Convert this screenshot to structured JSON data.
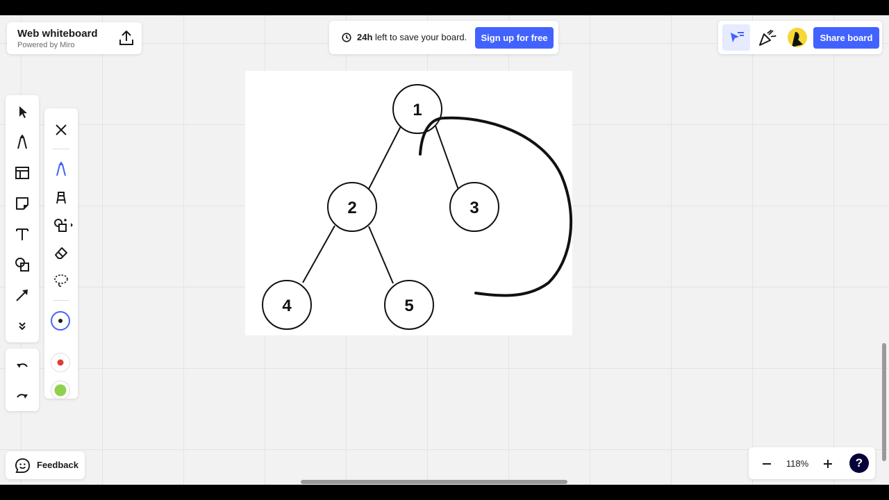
{
  "board": {
    "title": "Web whiteboard",
    "subtitle": "Powered by Miro"
  },
  "save_banner": {
    "hours_bold": "24h",
    "text": " left to save your board.",
    "signup_label": "Sign up for free"
  },
  "top_right": {
    "share_label": "Share board"
  },
  "toolbar": {
    "tools": [
      "select-icon",
      "pen-icon",
      "templates-icon",
      "sticky-note-icon",
      "text-icon",
      "shapes-icon",
      "arrow-icon",
      "more-tools-icon"
    ]
  },
  "pen_toolbar": {
    "tools": [
      "close-icon",
      "pen-icon",
      "highlighter-icon",
      "smart-draw-icon",
      "eraser-icon",
      "lasso-icon"
    ],
    "colors": [
      "#1a1a1a",
      "#e53935",
      "#8fd14f"
    ]
  },
  "diagram": {
    "nodes": [
      "1",
      "2",
      "3",
      "4",
      "5"
    ]
  },
  "feedback": {
    "label": "Feedback"
  },
  "zoom": {
    "value": "118%",
    "help": "?"
  },
  "colors": {
    "accent": "#4262ff",
    "help_bg": "#050038"
  }
}
